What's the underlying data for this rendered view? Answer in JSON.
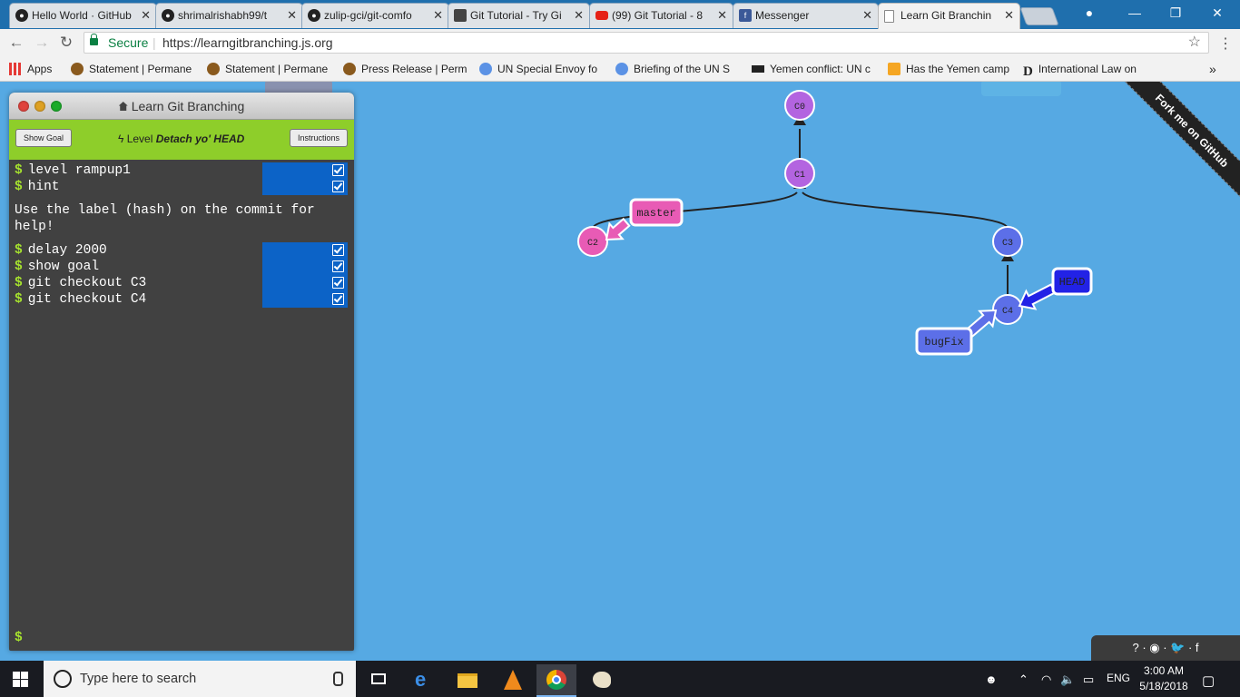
{
  "browser": {
    "tabs": [
      {
        "title": "Hello World · GitHub",
        "icon": "github-icon"
      },
      {
        "title": "shrimalrishabh99/t",
        "icon": "github-icon"
      },
      {
        "title": "zulip-gci/git-comfo",
        "icon": "github-icon"
      },
      {
        "title": "Git Tutorial - Try Gi",
        "icon": "git-tutorial-icon"
      },
      {
        "title": "(99) Git Tutorial - 8",
        "icon": "youtube-icon"
      },
      {
        "title": "Messenger",
        "icon": "facebook-icon"
      },
      {
        "title": "Learn Git Branchin",
        "icon": "page-icon"
      }
    ],
    "secure_label": "Secure",
    "url": "https://learngitbranching.js.org",
    "bookmarks": [
      {
        "label": "Apps",
        "icon": "apps-icon"
      },
      {
        "label": "Statement | Permane",
        "icon": "un-seal-icon"
      },
      {
        "label": "Statement | Permane",
        "icon": "un-seal-icon"
      },
      {
        "label": "Press Release | Perm",
        "icon": "un-seal-icon"
      },
      {
        "label": "UN Special Envoy fo",
        "icon": "un-logo-icon"
      },
      {
        "label": "Briefing of the UN S",
        "icon": "un-logo-icon"
      },
      {
        "label": "Yemen conflict: UN c",
        "icon": "bbc-icon"
      },
      {
        "label": "Has the Yemen camp",
        "icon": "ap-icon"
      },
      {
        "label": "International Law on",
        "icon": "d-icon"
      }
    ],
    "more_bookmarks": "»"
  },
  "terminal": {
    "title": "Learn Git Branching",
    "show_goal": "Show Goal",
    "instructions": "Instructions",
    "level_prefix": "Level",
    "level_name": "Detach yo' HEAD",
    "commands_before": [
      "level rampup1",
      "hint"
    ],
    "hint": "Use the label (hash) on the commit for help!",
    "commands_after": [
      "delay 2000",
      "show goal",
      "git checkout C3",
      "git checkout C4"
    ],
    "prompt": "$"
  },
  "graph": {
    "commits": [
      {
        "id": "C0",
        "color": "#b364e0"
      },
      {
        "id": "C1",
        "color": "#b364e0"
      },
      {
        "id": "C2",
        "color": "#e85bb5"
      },
      {
        "id": "C3",
        "color": "#5c6fe8"
      },
      {
        "id": "C4",
        "color": "#5c6fe8"
      }
    ],
    "refs": [
      {
        "name": "master",
        "target": "C2",
        "color": "#e85bb5"
      },
      {
        "name": "bugFix",
        "target": "C4",
        "color": "#5c6fe8"
      },
      {
        "name": "HEAD",
        "target": "C4",
        "color": "#2222e6"
      }
    ]
  },
  "ribbon": "Fork me on GitHub",
  "helpbar": "? · ◉ · 🐦 · f",
  "taskbar": {
    "search_placeholder": "Type here to search",
    "language": "ENG",
    "time": "3:00 AM",
    "date": "5/18/2018"
  }
}
